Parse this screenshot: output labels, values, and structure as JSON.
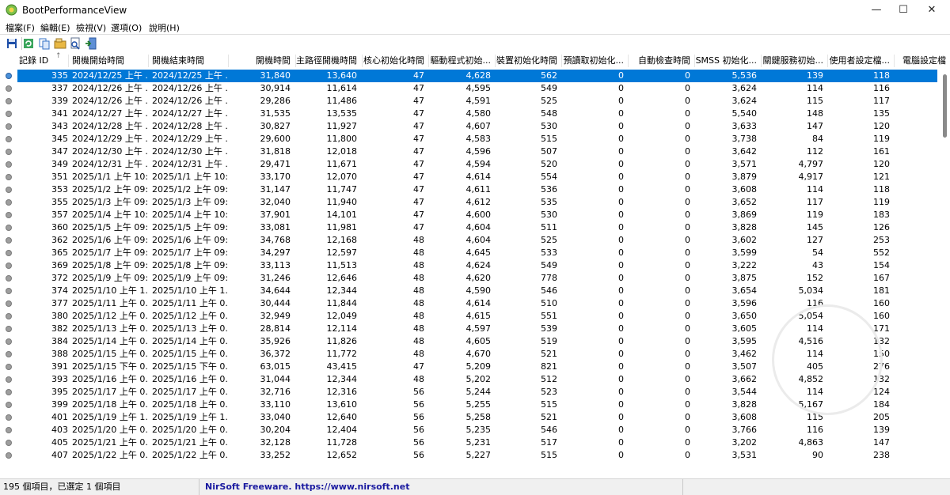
{
  "window": {
    "title": "BootPerformanceView",
    "minimize": "—",
    "maximize": "☐",
    "close": "✕"
  },
  "menu": [
    "檔案(F)",
    "編輯(E)",
    "檢視(V)",
    "選項(O)",
    "說明(H)"
  ],
  "toolbar": {
    "icons": [
      "save-icon",
      "refresh-icon",
      "copy-icon",
      "properties-icon",
      "html-report-icon",
      "exit-icon"
    ]
  },
  "columns": [
    "記錄 ID",
    "開機開始時間",
    "開機結束時間",
    "開機時間",
    "主路徑開機時間",
    "核心初始化時間",
    "驅動程式初始...",
    "裝置初始化時間",
    "預讀取初始化...",
    "自動檢查時間",
    "SMSS 初始化...",
    "關鍵服務初始...",
    "使用者設定檔...",
    "電腦設定檔"
  ],
  "sort_indicator": "↑",
  "rows": [
    [
      "335",
      "2024/12/25 上午 ...",
      "2024/12/25 上午 ...",
      "31,840",
      "13,640",
      "47",
      "4,628",
      "562",
      "0",
      "0",
      "5,536",
      "139",
      "118"
    ],
    [
      "337",
      "2024/12/26 上午 ...",
      "2024/12/26 上午 ...",
      "30,914",
      "11,614",
      "47",
      "4,595",
      "549",
      "0",
      "0",
      "3,624",
      "114",
      "116"
    ],
    [
      "339",
      "2024/12/26 上午 ...",
      "2024/12/26 上午 ...",
      "29,286",
      "11,486",
      "47",
      "4,591",
      "525",
      "0",
      "0",
      "3,624",
      "115",
      "117"
    ],
    [
      "341",
      "2024/12/27 上午 ...",
      "2024/12/27 上午 ...",
      "31,535",
      "13,535",
      "47",
      "4,580",
      "548",
      "0",
      "0",
      "5,540",
      "148",
      "135"
    ],
    [
      "343",
      "2024/12/28 上午 ...",
      "2024/12/28 上午 ...",
      "30,827",
      "11,927",
      "47",
      "4,607",
      "530",
      "0",
      "0",
      "3,633",
      "147",
      "120"
    ],
    [
      "345",
      "2024/12/29 上午 ...",
      "2024/12/29 上午 ...",
      "29,600",
      "11,800",
      "47",
      "4,583",
      "515",
      "0",
      "0",
      "3,738",
      "84",
      "119"
    ],
    [
      "347",
      "2024/12/30 上午 ...",
      "2024/12/30 上午 ...",
      "31,818",
      "12,018",
      "47",
      "4,596",
      "507",
      "0",
      "0",
      "3,642",
      "112",
      "161"
    ],
    [
      "349",
      "2024/12/31 上午 ...",
      "2024/12/31 上午 ...",
      "29,471",
      "11,671",
      "47",
      "4,594",
      "520",
      "0",
      "0",
      "3,571",
      "4,797",
      "120"
    ],
    [
      "351",
      "2025/1/1 上午 10:...",
      "2025/1/1 上午 10:...",
      "33,170",
      "12,070",
      "47",
      "4,614",
      "554",
      "0",
      "0",
      "3,879",
      "4,917",
      "121"
    ],
    [
      "353",
      "2025/1/2 上午 09:...",
      "2025/1/2 上午 09:...",
      "31,147",
      "11,747",
      "47",
      "4,611",
      "536",
      "0",
      "0",
      "3,608",
      "114",
      "118"
    ],
    [
      "355",
      "2025/1/3 上午 09:...",
      "2025/1/3 上午 09:...",
      "32,040",
      "11,940",
      "47",
      "4,612",
      "535",
      "0",
      "0",
      "3,652",
      "117",
      "119"
    ],
    [
      "357",
      "2025/1/4 上午 10:...",
      "2025/1/4 上午 10:...",
      "37,901",
      "14,101",
      "47",
      "4,600",
      "530",
      "0",
      "0",
      "3,869",
      "119",
      "183"
    ],
    [
      "360",
      "2025/1/5 上午 09:...",
      "2025/1/5 上午 09:...",
      "33,081",
      "11,981",
      "47",
      "4,604",
      "511",
      "0",
      "0",
      "3,828",
      "145",
      "126"
    ],
    [
      "362",
      "2025/1/6 上午 09:...",
      "2025/1/6 上午 09:...",
      "34,768",
      "12,168",
      "48",
      "4,604",
      "525",
      "0",
      "0",
      "3,602",
      "127",
      "253"
    ],
    [
      "365",
      "2025/1/7 上午 09:...",
      "2025/1/7 上午 09:...",
      "34,297",
      "12,597",
      "48",
      "4,645",
      "533",
      "0",
      "0",
      "3,599",
      "54",
      "552"
    ],
    [
      "369",
      "2025/1/8 上午 09:...",
      "2025/1/8 上午 09:...",
      "33,113",
      "11,513",
      "48",
      "4,624",
      "549",
      "0",
      "0",
      "3,222",
      "43",
      "154"
    ],
    [
      "372",
      "2025/1/9 上午 09:...",
      "2025/1/9 上午 09:...",
      "31,246",
      "12,646",
      "48",
      "4,620",
      "778",
      "0",
      "0",
      "3,875",
      "152",
      "167"
    ],
    [
      "374",
      "2025/1/10 上午 1...",
      "2025/1/10 上午 1...",
      "34,644",
      "12,344",
      "48",
      "4,590",
      "546",
      "0",
      "0",
      "3,654",
      "5,034",
      "181"
    ],
    [
      "377",
      "2025/1/11 上午 0...",
      "2025/1/11 上午 0...",
      "30,444",
      "11,844",
      "48",
      "4,614",
      "510",
      "0",
      "0",
      "3,596",
      "116",
      "160"
    ],
    [
      "380",
      "2025/1/12 上午 0...",
      "2025/1/12 上午 0...",
      "32,949",
      "12,049",
      "48",
      "4,615",
      "551",
      "0",
      "0",
      "3,650",
      "5,054",
      "160"
    ],
    [
      "382",
      "2025/1/13 上午 0...",
      "2025/1/13 上午 0...",
      "28,814",
      "12,114",
      "48",
      "4,597",
      "539",
      "0",
      "0",
      "3,605",
      "114",
      "171"
    ],
    [
      "384",
      "2025/1/14 上午 0...",
      "2025/1/14 上午 0...",
      "35,926",
      "11,826",
      "48",
      "4,605",
      "519",
      "0",
      "0",
      "3,595",
      "4,516",
      "132"
    ],
    [
      "388",
      "2025/1/15 上午 0...",
      "2025/1/15 上午 0...",
      "36,372",
      "11,772",
      "48",
      "4,670",
      "521",
      "0",
      "0",
      "3,462",
      "114",
      "150"
    ],
    [
      "391",
      "2025/1/15 下午 0...",
      "2025/1/15 下午 0...",
      "63,015",
      "43,415",
      "47",
      "5,209",
      "821",
      "0",
      "0",
      "3,507",
      "405",
      "276"
    ],
    [
      "393",
      "2025/1/16 上午 0...",
      "2025/1/16 上午 0...",
      "31,044",
      "12,344",
      "48",
      "5,202",
      "512",
      "0",
      "0",
      "3,662",
      "4,852",
      "132"
    ],
    [
      "395",
      "2025/1/17 上午 0...",
      "2025/1/17 上午 0...",
      "32,716",
      "12,316",
      "56",
      "5,244",
      "523",
      "0",
      "0",
      "3,544",
      "114",
      "124"
    ],
    [
      "399",
      "2025/1/18 上午 0...",
      "2025/1/18 上午 0...",
      "33,110",
      "13,610",
      "56",
      "5,255",
      "515",
      "0",
      "0",
      "3,828",
      "5,167",
      "184"
    ],
    [
      "401",
      "2025/1/19 上午 1...",
      "2025/1/19 上午 1...",
      "33,040",
      "12,640",
      "56",
      "5,258",
      "521",
      "0",
      "0",
      "3,608",
      "115",
      "205"
    ],
    [
      "403",
      "2025/1/20 上午 0...",
      "2025/1/20 上午 0...",
      "30,204",
      "12,404",
      "56",
      "5,235",
      "546",
      "0",
      "0",
      "3,766",
      "116",
      "139"
    ],
    [
      "405",
      "2025/1/21 上午 0...",
      "2025/1/21 上午 0...",
      "32,128",
      "11,728",
      "56",
      "5,231",
      "517",
      "0",
      "0",
      "3,202",
      "4,863",
      "147"
    ],
    [
      "407",
      "2025/1/22 上午 0...",
      "2025/1/22 上午 0...",
      "33,252",
      "12,652",
      "56",
      "5,227",
      "515",
      "0",
      "0",
      "3,531",
      "90",
      "238"
    ]
  ],
  "selected_row_index": 0,
  "status": {
    "count": "195 個項目，已選定 1 個項目",
    "credit": "NirSoft Freeware. https://www.nirsoft.net"
  }
}
